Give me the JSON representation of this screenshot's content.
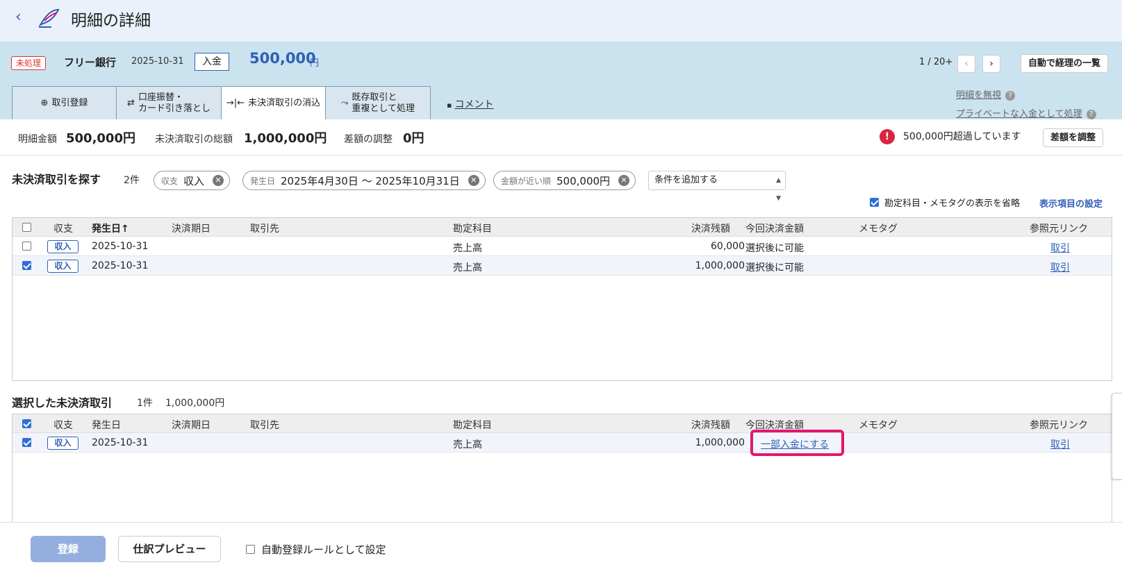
{
  "header": {
    "title": "明細の詳細"
  },
  "txn": {
    "status": "未処理",
    "bank": "フリー銀行",
    "date": "2025-10-31",
    "direction": "入金",
    "amount": "500,000",
    "unit": "円",
    "pager": "1 / 20+",
    "list_button": "自動で経理の一覧"
  },
  "tabs": [
    {
      "label": "取引登録"
    },
    {
      "line1": "口座振替・",
      "line2": "カード引き落とし"
    },
    {
      "label": "未決済取引の消込"
    },
    {
      "line1": "既存取引と",
      "line2": "重複として処理"
    }
  ],
  "comment": "コメント",
  "right_links": {
    "ignore": "明細を無視",
    "private": "プライベートな入金として処理"
  },
  "summary": {
    "detail_label": "明細金額",
    "detail_value": "500,000円",
    "total_label": "未決済取引の総額",
    "total_value": "1,000,000円",
    "diff_label": "差額の調整",
    "diff_value": "0円",
    "warning": "500,000円超過しています",
    "adjust_button": "差額を調整"
  },
  "search": {
    "title": "未決済取引を探す",
    "count": "2件",
    "chips": [
      {
        "label": "収支",
        "value": "収入"
      },
      {
        "label": "発生日",
        "value": "2025年4月30日 〜 2025年10月31日"
      },
      {
        "label": "金額が近い順",
        "value": "500,000円"
      }
    ],
    "add_condition": "条件を追加する",
    "omit_option": "勘定科目・メモタグの表示を省略",
    "display_settings": "表示項目の設定"
  },
  "columns": {
    "type": "収支",
    "date": "発生日",
    "date_sorted": "発生日↑",
    "due": "決済期日",
    "partner": "取引先",
    "account": "勘定科目",
    "balance": "決済残額",
    "current": "今回決済金額",
    "memo": "メモタグ",
    "ref": "参照元リンク"
  },
  "results": [
    {
      "type": "収入",
      "date": "2025-10-31",
      "account": "売上高",
      "balance": "60,000",
      "current": "選択後に可能",
      "ref": "取引",
      "checked": false
    },
    {
      "type": "収入",
      "date": "2025-10-31",
      "account": "売上高",
      "balance": "1,000,000",
      "current": "選択後に可能",
      "ref": "取引",
      "checked": true
    }
  ],
  "selected": {
    "title": "選択した未決済取引",
    "count": "1件",
    "total": "1,000,000円",
    "rows": [
      {
        "type": "収入",
        "date": "2025-10-31",
        "account": "売上高",
        "balance": "1,000,000",
        "current": "一部入金にする",
        "ref": "取引",
        "checked": true
      }
    ]
  },
  "footer": {
    "register": "登録",
    "preview": "仕訳プレビュー",
    "auto_rule": "自動登録ルールとして設定"
  }
}
